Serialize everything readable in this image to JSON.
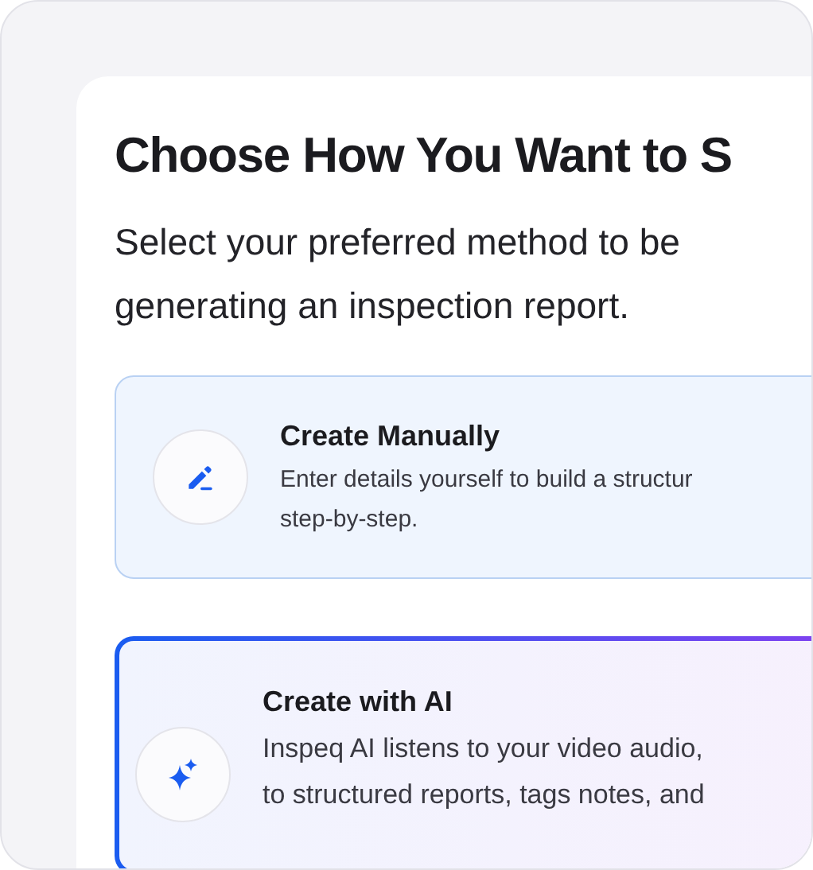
{
  "title": "Choose How You Want to S",
  "subtitle_lines": [
    "Select your preferred method to be",
    "generating an inspection report."
  ],
  "options": [
    {
      "kind": "manual",
      "title": "Create Manually",
      "description_lines": [
        "Enter details yourself to build a structur",
        "step-by-step."
      ],
      "selected": false
    },
    {
      "kind": "ai",
      "title": "Create with AI",
      "description_lines": [
        "Inspeq AI listens to your video audio,",
        "to structured reports, tags notes, and"
      ],
      "selected": true
    }
  ]
}
